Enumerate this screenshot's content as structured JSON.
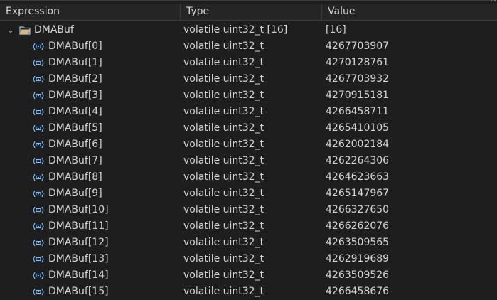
{
  "columns": {
    "expression": "Expression",
    "type": "Type",
    "value": "Value"
  },
  "root": {
    "name": "DMABuf",
    "type": "volatile uint32_t [16]",
    "value": "[16]",
    "expanded": true
  },
  "child_type": "volatile uint32_t",
  "rows": [
    {
      "name": "DMABuf[0]",
      "type": "volatile uint32_t",
      "value": "4267703907"
    },
    {
      "name": "DMABuf[1]",
      "type": "volatile uint32_t",
      "value": "4270128761"
    },
    {
      "name": "DMABuf[2]",
      "type": "volatile uint32_t",
      "value": "4267703932"
    },
    {
      "name": "DMABuf[3]",
      "type": "volatile uint32_t",
      "value": "4270915181"
    },
    {
      "name": "DMABuf[4]",
      "type": "volatile uint32_t",
      "value": "4266458711"
    },
    {
      "name": "DMABuf[5]",
      "type": "volatile uint32_t",
      "value": "4265410105"
    },
    {
      "name": "DMABuf[6]",
      "type": "volatile uint32_t",
      "value": "4262002184"
    },
    {
      "name": "DMABuf[7]",
      "type": "volatile uint32_t",
      "value": "4262264306"
    },
    {
      "name": "DMABuf[8]",
      "type": "volatile uint32_t",
      "value": "4264623663"
    },
    {
      "name": "DMABuf[9]",
      "type": "volatile uint32_t",
      "value": "4265147967"
    },
    {
      "name": "DMABuf[10]",
      "type": "volatile uint32_t",
      "value": "4266327650"
    },
    {
      "name": "DMABuf[11]",
      "type": "volatile uint32_t",
      "value": "4266262076"
    },
    {
      "name": "DMABuf[12]",
      "type": "volatile uint32_t",
      "value": "4263509565"
    },
    {
      "name": "DMABuf[13]",
      "type": "volatile uint32_t",
      "value": "4262919689"
    },
    {
      "name": "DMABuf[14]",
      "type": "volatile uint32_t",
      "value": "4263509526"
    },
    {
      "name": "DMABuf[15]",
      "type": "volatile uint32_t",
      "value": "4266458676"
    }
  ],
  "colors": {
    "background": "#1e1e1e",
    "header_background": "#252526",
    "separator": "#3c3c3c",
    "text": "#d4d4d4",
    "folder_icon": "#dcb67a",
    "element_icon": "#75beff"
  },
  "icons": {
    "expand": "chevron-down-icon",
    "root": "folder-icon",
    "element": "field-icon"
  }
}
